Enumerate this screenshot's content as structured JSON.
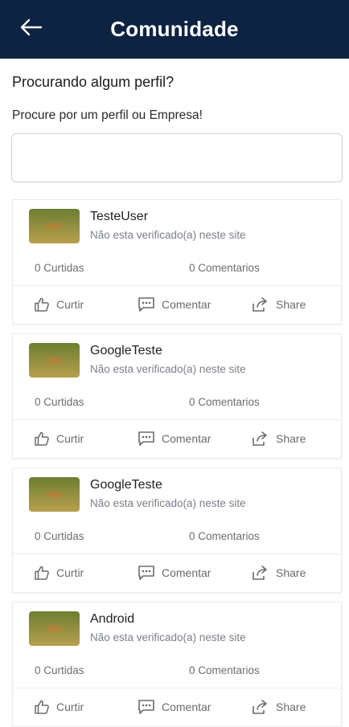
{
  "appbar": {
    "title": "Comunidade",
    "back_icon": "arrow-left-icon"
  },
  "search": {
    "heading": "Procurando algum perfil?",
    "subtitle": "Procure por um perfil ou Empresa!",
    "value": "",
    "placeholder": ""
  },
  "profiles": [
    {
      "name": "TesteUser",
      "status": "Não esta verificado(a) neste site",
      "likes": "0 Curtidas",
      "comments": "0 Comentarios"
    },
    {
      "name": "GoogleTeste",
      "status": "Não esta verificado(a) neste site",
      "likes": "0 Curtidas",
      "comments": "0 Comentarios"
    },
    {
      "name": "GoogleTeste",
      "status": "Não esta verificado(a) neste site",
      "likes": "0 Curtidas",
      "comments": "0 Comentarios"
    },
    {
      "name": "Android",
      "status": "Não esta verificado(a) neste site",
      "likes": "0 Curtidas",
      "comments": "0 Comentarios"
    }
  ],
  "actions": {
    "like": "Curtir",
    "comment": "Comentar",
    "share": "Share"
  },
  "colors": {
    "appbar": "#0d2341",
    "muted_text": "#7b7f8a"
  }
}
